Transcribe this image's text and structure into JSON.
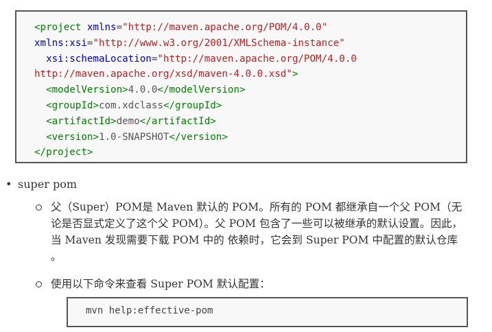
{
  "xml": {
    "l1": {
      "open": "<project",
      "attr": "xmlns",
      "eq": "=",
      "val": "\"http://maven.apache.org/POM/4.0.0\""
    },
    "l2": {
      "attr": "xmlns:xsi",
      "eq": "=",
      "val": "\"http://www.w3.org/2001/XMLSchema-instance\""
    },
    "l3": {
      "attr": "xsi:schemaLocation",
      "eq": "=",
      "val": "\"http://maven.apache.org/POM/4.0.0"
    },
    "l4": {
      "val": "http://maven.apache.org/xsd/maven-4.0.0.xsd\"",
      "close": ">"
    },
    "model": {
      "open": "<modelVersion>",
      "value": "4.0.0",
      "close": "</modelVersion>"
    },
    "group": {
      "open": "<groupId>",
      "value": "com.xdclass",
      "close": "</groupId>"
    },
    "artifact": {
      "open": "<artifactId>",
      "value": "demo",
      "close": "</artifactId>"
    },
    "version": {
      "open": "<version>",
      "value": "1.0-SNAPSHOT",
      "close": "</version>"
    },
    "end": "</project>"
  },
  "bullet": {
    "glyph": "•",
    "label": "super pom"
  },
  "sub1": "父（Super）POM是 Maven 默认的 POM。所有的 POM 都继承自一个父 POM（无论是否显式定义了这个父 POM）。父 POM 包含了一些可以被继承的默认设置。因此，当 Maven 发现需要下载 POM 中的 依赖时，它会到 Super POM 中配置的默认仓库 。",
  "sub2": "使用以下命令来查看 Super POM 默认配置：",
  "command": "mvn help:effective-pom"
}
